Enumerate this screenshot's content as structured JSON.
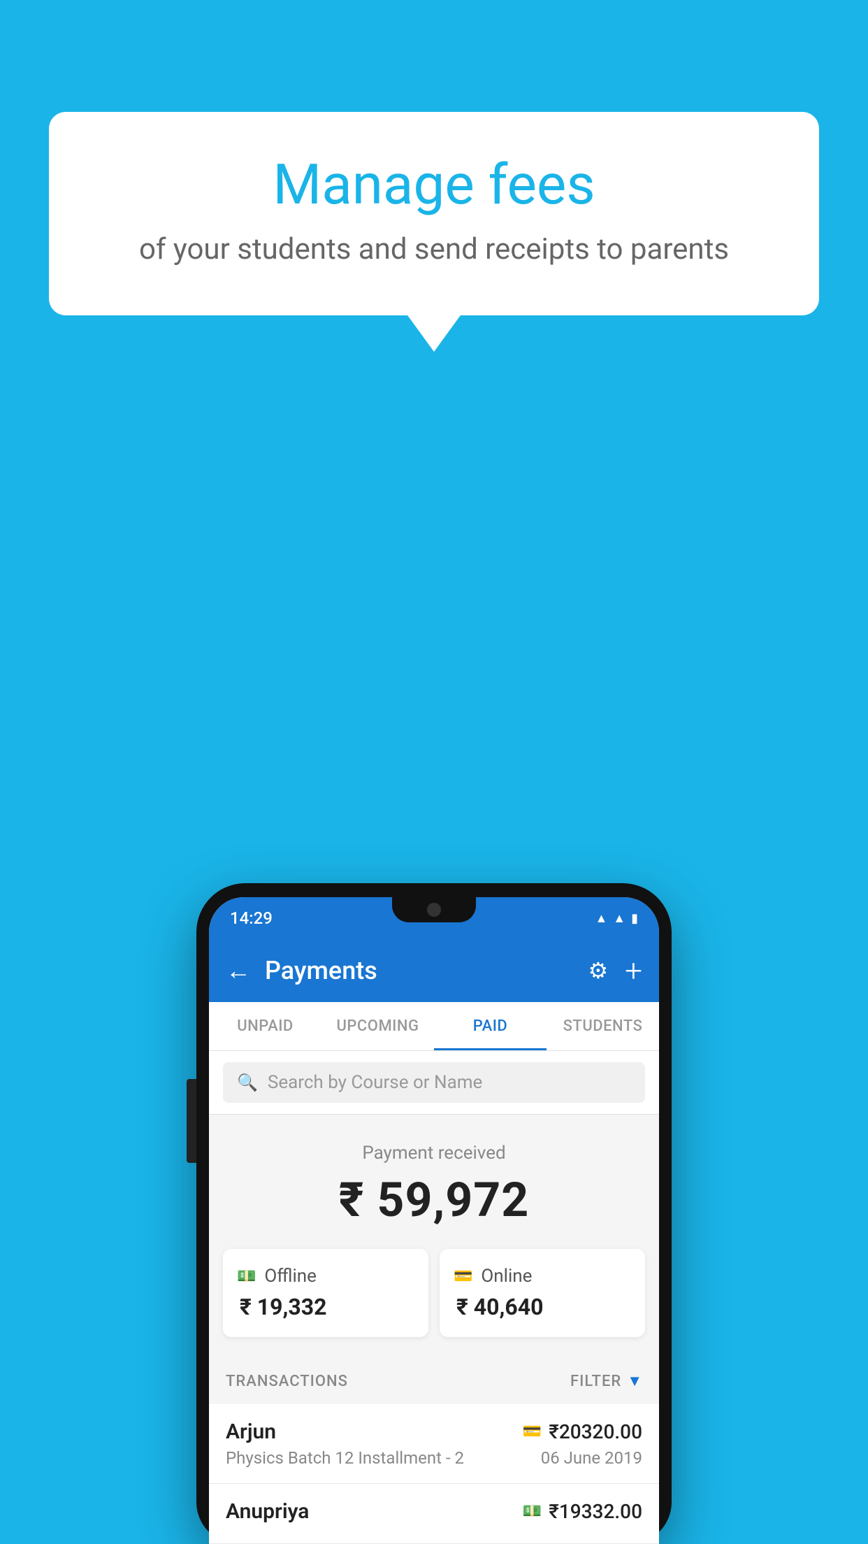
{
  "page": {
    "background_color": "#1ab4e8"
  },
  "speech_bubble": {
    "title": "Manage fees",
    "subtitle": "of your students and send receipts to parents"
  },
  "status_bar": {
    "time": "14:29",
    "wifi_icon": "wifi",
    "signal_icon": "signal",
    "battery_icon": "battery"
  },
  "app_bar": {
    "back_icon": "back-arrow",
    "title": "Payments",
    "settings_icon": "gear",
    "add_icon": "plus"
  },
  "tabs": [
    {
      "label": "UNPAID",
      "active": false
    },
    {
      "label": "UPCOMING",
      "active": false
    },
    {
      "label": "PAID",
      "active": true
    },
    {
      "label": "STUDENTS",
      "active": false
    }
  ],
  "search": {
    "placeholder": "Search by Course or Name"
  },
  "payment_summary": {
    "label": "Payment received",
    "amount": "₹ 59,972",
    "offline": {
      "type": "Offline",
      "amount": "₹ 19,332",
      "icon": "cash-icon"
    },
    "online": {
      "type": "Online",
      "amount": "₹ 40,640",
      "icon": "card-icon"
    }
  },
  "transactions": {
    "header_label": "TRANSACTIONS",
    "filter_label": "FILTER",
    "items": [
      {
        "name": "Arjun",
        "course": "Physics Batch 12 Installment - 2",
        "amount": "₹20320.00",
        "date": "06 June 2019",
        "payment_type": "card"
      },
      {
        "name": "Anupriya",
        "course": "",
        "amount": "₹19332.00",
        "date": "",
        "payment_type": "cash"
      }
    ]
  }
}
